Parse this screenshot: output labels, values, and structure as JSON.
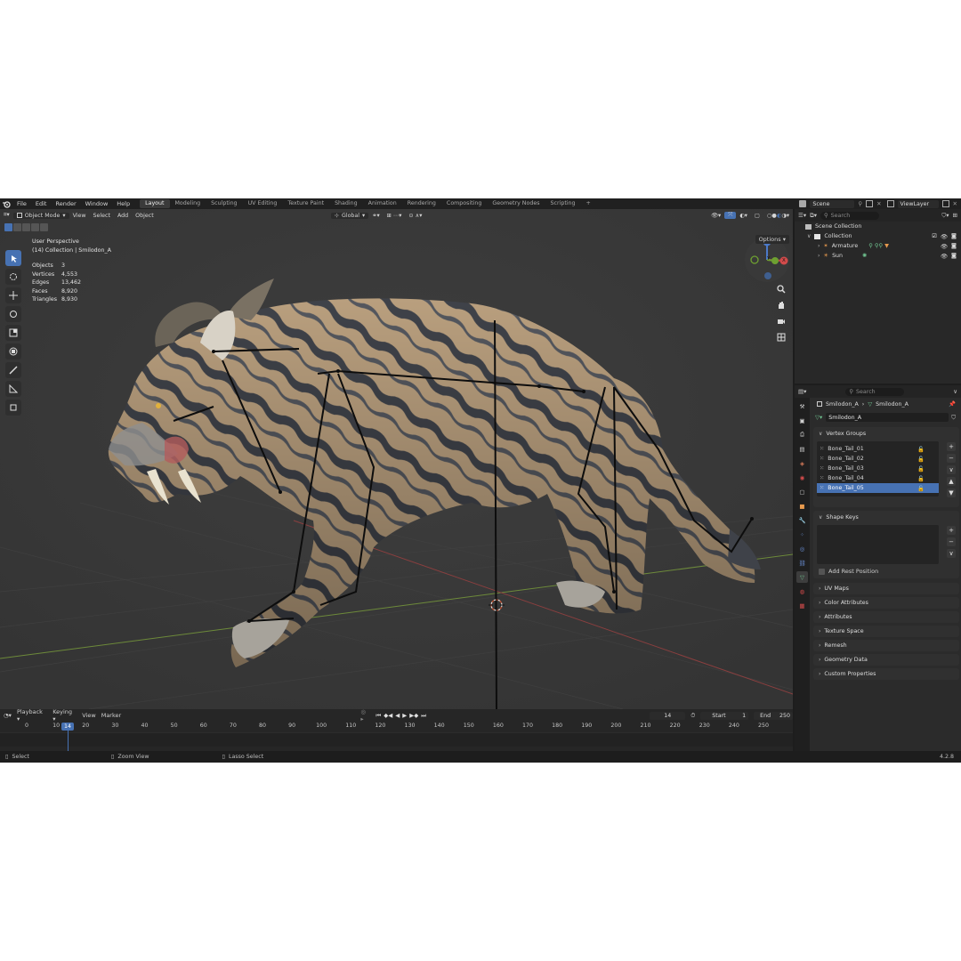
{
  "colors": {
    "accent": "#4772b3",
    "viewport_bg": "#393939",
    "panel_bg": "#2b2b2b"
  },
  "menu": [
    "File",
    "Edit",
    "Render",
    "Window",
    "Help"
  ],
  "workspaces": [
    {
      "label": "Layout",
      "active": true
    },
    {
      "label": "Modeling"
    },
    {
      "label": "Sculpting"
    },
    {
      "label": "UV Editing"
    },
    {
      "label": "Texture Paint"
    },
    {
      "label": "Shading"
    },
    {
      "label": "Animation"
    },
    {
      "label": "Rendering"
    },
    {
      "label": "Compositing"
    },
    {
      "label": "Geometry Nodes"
    },
    {
      "label": "Scripting"
    }
  ],
  "scene": {
    "label": "Scene",
    "view_layer": "ViewLayer"
  },
  "viewport_header": {
    "mode": "Object Mode",
    "menus": [
      "View",
      "Select",
      "Add",
      "Object"
    ],
    "orientation": "Global",
    "options": "Options"
  },
  "viewport_info": {
    "perspective": "User Perspective",
    "collection": "(14) Collection | Smilodon_A",
    "stats": [
      {
        "k": "Objects",
        "v": "3"
      },
      {
        "k": "Vertices",
        "v": "4,553"
      },
      {
        "k": "Edges",
        "v": "13,462"
      },
      {
        "k": "Faces",
        "v": "8,920"
      },
      {
        "k": "Triangles",
        "v": "8,930"
      }
    ]
  },
  "gizmo": {
    "x": "X",
    "y": "Y",
    "z": "Z"
  },
  "timeline": {
    "menus": [
      "Playback",
      "Keying",
      "View",
      "Marker"
    ],
    "current_frame": "14",
    "start_label": "Start",
    "start": "1",
    "end_label": "End",
    "end": "250",
    "ticks": [
      "0",
      "10",
      "20",
      "30",
      "40",
      "50",
      "60",
      "70",
      "80",
      "90",
      "100",
      "110",
      "120",
      "130",
      "140",
      "150",
      "160",
      "170",
      "180",
      "190",
      "200",
      "210",
      "220",
      "230",
      "240",
      "250"
    ]
  },
  "statusbar": {
    "select": "Select",
    "zoom": "Zoom View",
    "lasso": "Lasso Select",
    "version": "4.2.8"
  },
  "outliner": {
    "search_placeholder": "Search",
    "scene_collection": "Scene Collection",
    "collection": "Collection",
    "items": [
      {
        "name": "Armature"
      },
      {
        "name": "Sun"
      }
    ]
  },
  "properties": {
    "search_placeholder": "Search",
    "breadcrumb_object": "Smilodon_A",
    "breadcrumb_data": "Smilodon_A",
    "data_name": "Smilodon_A",
    "vertex_groups_title": "Vertex Groups",
    "vertex_groups": [
      {
        "name": "Bone_Tail_01"
      },
      {
        "name": "Bone_Tail_02"
      },
      {
        "name": "Bone_Tail_03"
      },
      {
        "name": "Bone_Tail_04"
      },
      {
        "name": "Bone_Tail_05",
        "selected": true
      }
    ],
    "shape_keys_title": "Shape Keys",
    "add_rest_position": "Add Rest Position",
    "collapsed_panels": [
      "UV Maps",
      "Color Attributes",
      "Attributes",
      "Texture Space",
      "Remesh",
      "Geometry Data",
      "Custom Properties"
    ]
  }
}
